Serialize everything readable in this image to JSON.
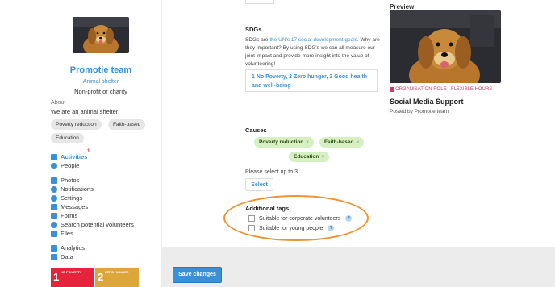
{
  "organisation": {
    "name": "Promotie team",
    "category": "Animal shelter",
    "type": "Non-profit or charity",
    "about_heading": "About",
    "about_text": "We are an animal shelter",
    "tags": [
      "Poverty reduction",
      "Faith-based",
      "Education"
    ]
  },
  "nav": {
    "activities": "Activities",
    "activities_badge": "1",
    "people": "People",
    "photos": "Photos",
    "notifications": "Notifications",
    "settings": "Settings",
    "messages": "Messages",
    "forms": "Forms",
    "search_volunteers": "Search potential volunteers",
    "files": "Files",
    "analytics": "Analytics",
    "data": "Data"
  },
  "sdg_tiles": [
    {
      "num": "1",
      "label": "NO POVERTY",
      "color": "#e5243b"
    },
    {
      "num": "2",
      "label": "ZERO HUNGER",
      "color": "#dda63a"
    }
  ],
  "form": {
    "sdgs_heading": "SDGs",
    "sdgs_desc_1": "SDGs are ",
    "sdgs_link": "the UN's 17 social development goals",
    "sdgs_desc_2": ". Why are they important? By using SDG's we can all measure our joint impact and provide more insight into the value of volunteering!",
    "sdgs_selected": "1 No Poverty, 2 Zero hunger, 3 Good health and well-being",
    "causes_heading": "Causes",
    "causes": [
      "Poverty reduction",
      "Faith-based",
      "Education"
    ],
    "causes_hint": "Please select up to 3",
    "select_label": "Select",
    "additional_heading": "Additional tags",
    "checkbox_corporate": "Suitable for corporate volunteers",
    "checkbox_young": "Suitable for young people",
    "help_glyph": "?",
    "remove_glyph": "×"
  },
  "preview": {
    "heading": "Preview",
    "role": "ORGANISATION ROLE · FLEXIBLE HOURS",
    "title": "Social Media Support",
    "posted_by": "Posted by Promotie team"
  },
  "actions": {
    "save": "Save changes"
  },
  "colors": {
    "accent": "#3a8fd6",
    "highlight_oval": "#ee9434",
    "cause_pill": "#d6f0c2"
  }
}
